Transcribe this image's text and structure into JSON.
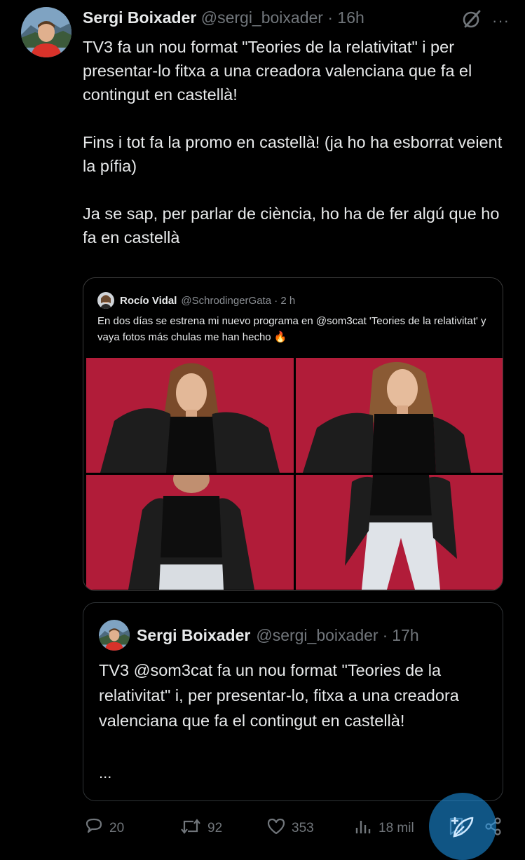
{
  "tweet": {
    "author_name": "Sergi Boixader",
    "author_handle": "@sergi_boixader",
    "separator": "·",
    "time": "16h",
    "more_label": "···",
    "paragraphs": [
      "TV3 fa un nou format \"Teories de la relativitat\" i per presentar-lo fitxa a una creadora valenciana que fa el contingut en castellà!",
      "Fins i tot fa la promo en castellà! (ja ho ha esborrat veient la pífia)",
      "Ja se sap, per parlar de ciència, ho ha de fer algú que ho fa en castellà"
    ]
  },
  "screenshot_card": {
    "author_name": "Rocío Vidal",
    "author_handle": "@SchrodingerGata · 2 h",
    "text": "En dos días se estrena mi nuevo programa en @som3cat 'Teories de la relativitat' y vaya fotos más chulas me han hecho 🔥",
    "photo_color": "#b11c39"
  },
  "quoted_tweet": {
    "author_name": "Sergi Boixader",
    "author_handle": "@sergi_boixader",
    "separator": "·",
    "time": "17h",
    "text": "TV3 @som3cat fa un nou format \"Teories de la relativitat\" i, per presentar-lo, fitxa a una creadora valenciana que fa el contingut en castellà!",
    "ellipsis": "..."
  },
  "actions": {
    "replies": "20",
    "reposts": "92",
    "likes": "353",
    "views": "18 mil"
  },
  "colors": {
    "background": "#000000",
    "text": "#e7e9ea",
    "muted": "#71767b",
    "accent": "#1d9bf0",
    "border": "#2f3336"
  },
  "icons": [
    "grok-icon",
    "more-icon",
    "reply-icon",
    "repost-icon",
    "like-icon",
    "views-icon",
    "bookmark-icon",
    "share-icon",
    "compose-icon"
  ]
}
